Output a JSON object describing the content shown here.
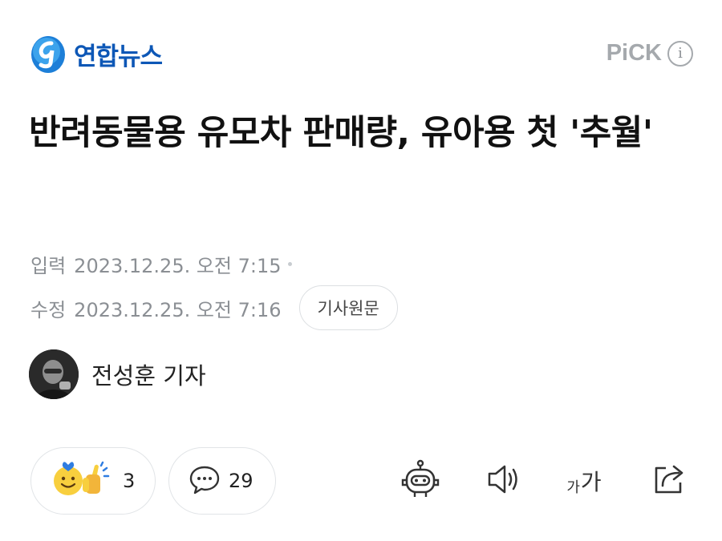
{
  "header": {
    "logo_text": "연합뉴스",
    "pick_label": "PiCK",
    "info_glyph": "i",
    "brand_color": "#0d57b6"
  },
  "article": {
    "title": "반려동물용 유모차 판매량, 유아용 첫 '추월'",
    "published_label": "입력",
    "published_time": "2023.12.25. 오전 7:15",
    "modified_label": "수정",
    "modified_time": "2023.12.25. 오전 7:16",
    "source_button": "기사원문"
  },
  "reporter": {
    "name": "전성훈 기자"
  },
  "actions": {
    "reaction_count": "3",
    "comment_count": "29",
    "font_small": "가",
    "font_big": "가",
    "icons": [
      "reaction-emoji-icon",
      "comment-bubble-icon",
      "ai-bot-icon",
      "speaker-icon",
      "font-size-icon",
      "share-icon"
    ]
  }
}
